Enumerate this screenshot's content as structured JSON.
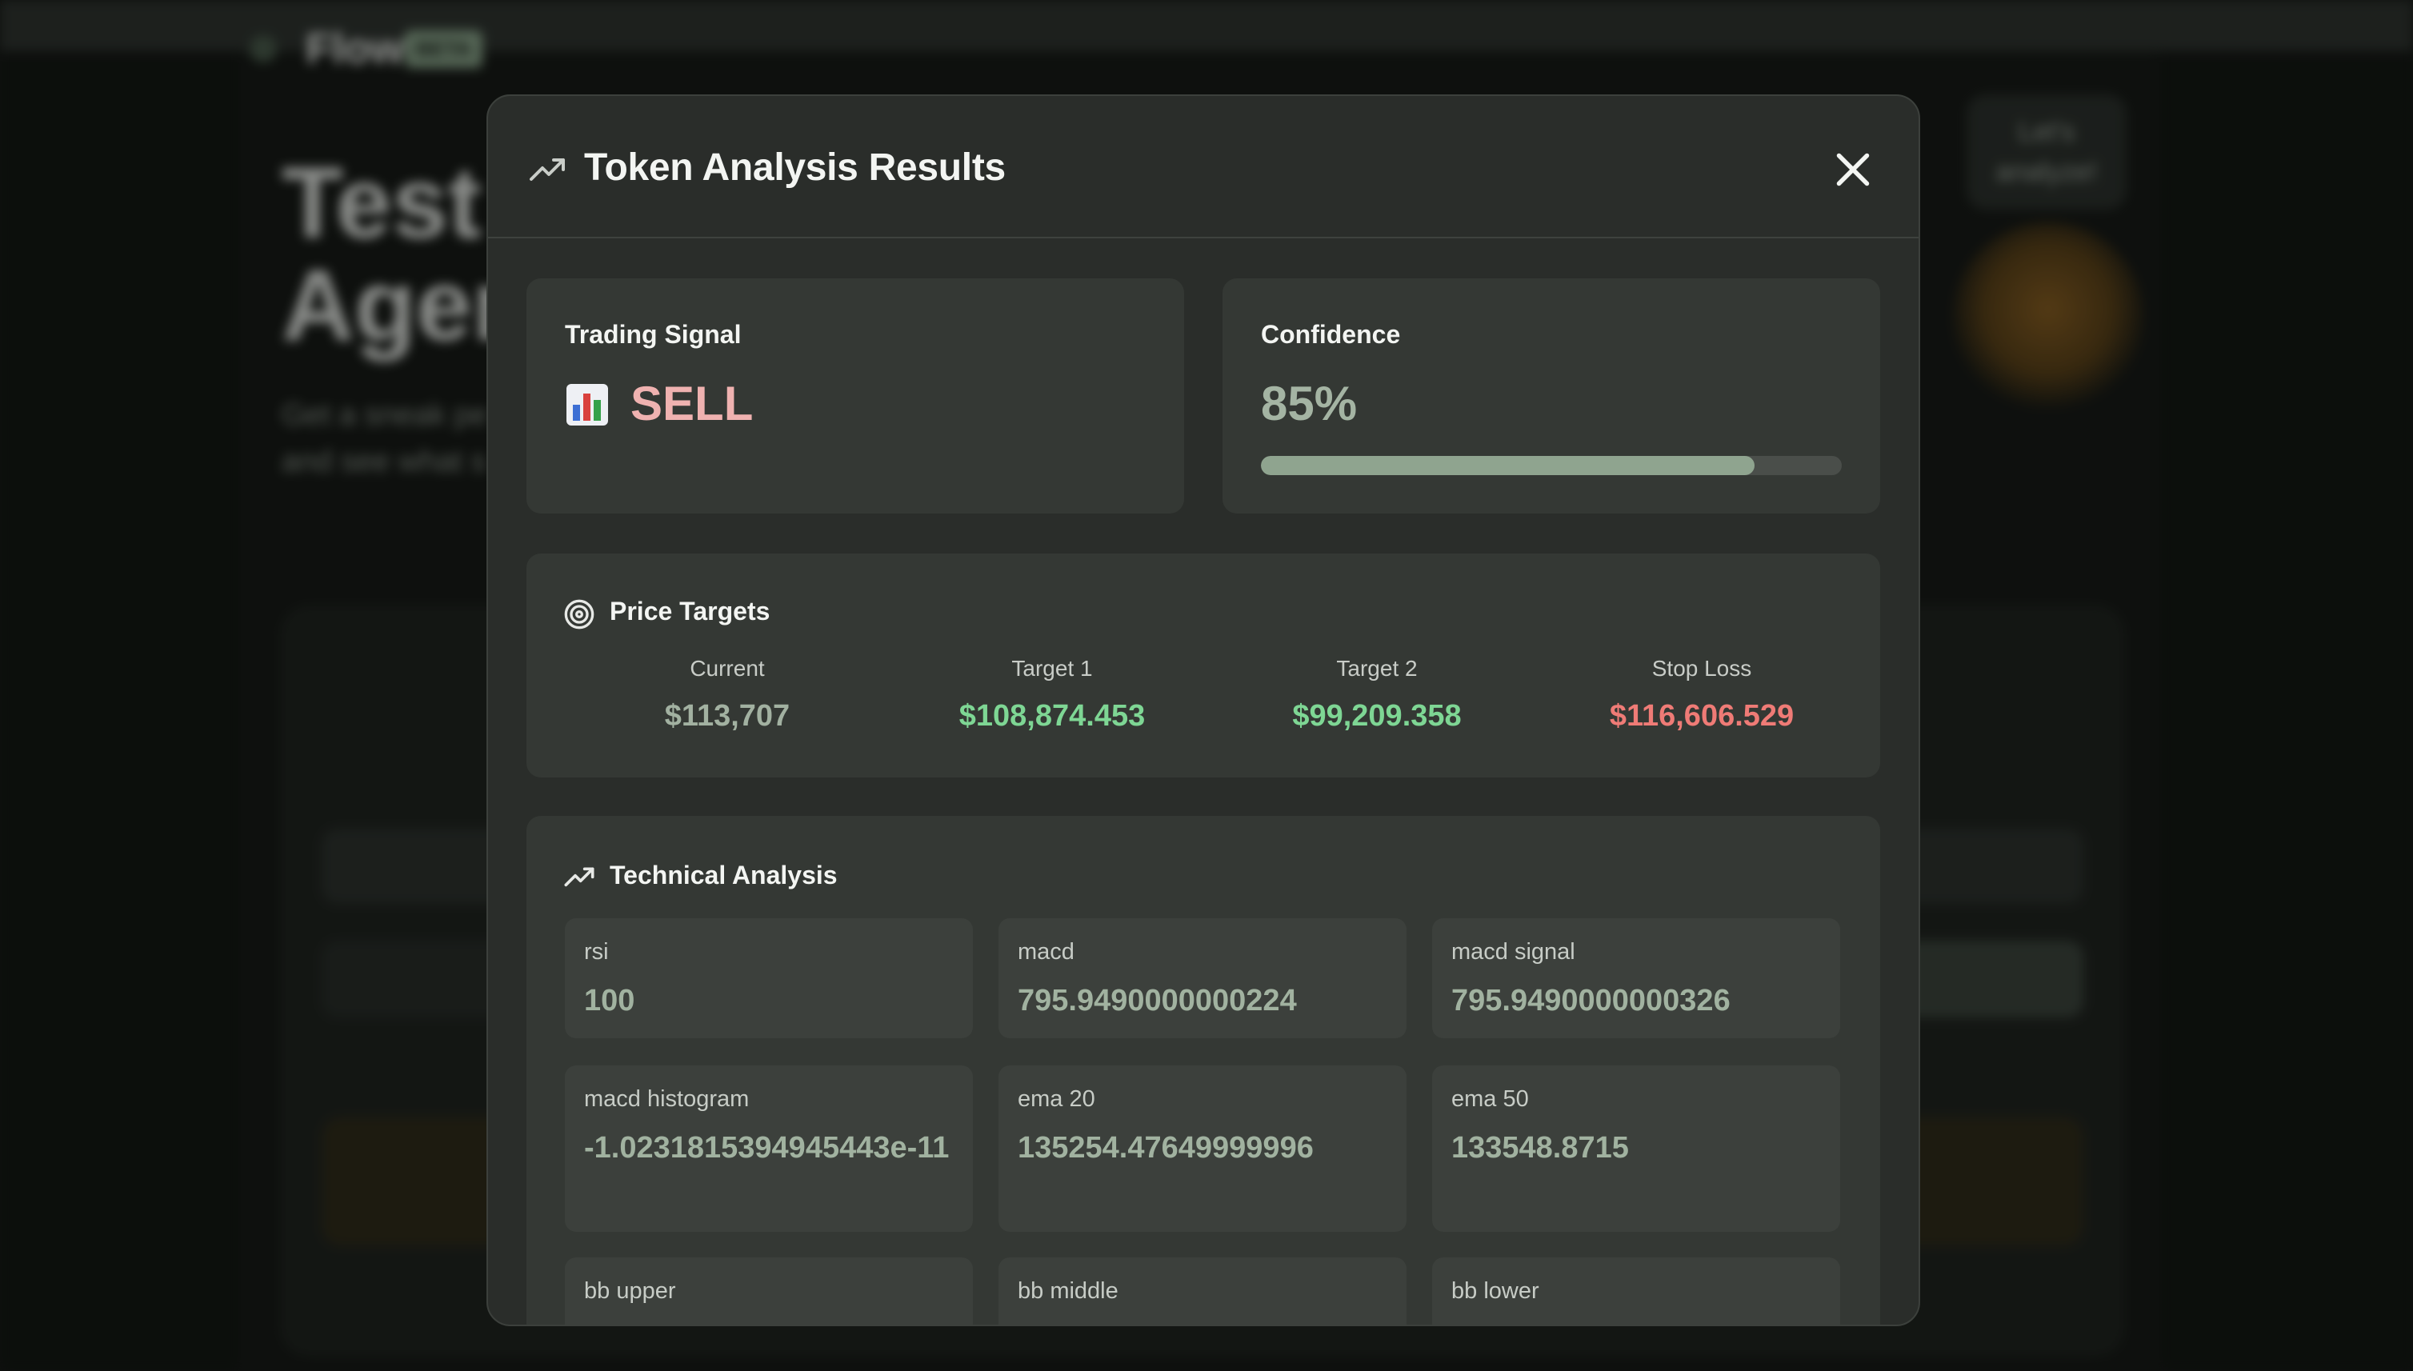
{
  "background": {
    "app_name": "Flow",
    "beta_badge": "BETA",
    "hero_title_line1": "Test",
    "hero_title_line2": "Agen",
    "hero_sub_line1": "Get a sneak pe",
    "hero_sub_line2": "and see what s",
    "cta_label": "Let's analyze!"
  },
  "modal": {
    "title": "Token Analysis Results",
    "header_icon": "trending-up-icon",
    "close_icon": "close-icon"
  },
  "signal": {
    "label": "Trading Signal",
    "icon": "bar-chart-emoji-icon",
    "value": "SELL",
    "color": "#efb2b0"
  },
  "confidence": {
    "label": "Confidence",
    "value": "85%",
    "fraction": 0.85,
    "bar_color": "#8fa48f"
  },
  "price_targets": {
    "label": "Price Targets",
    "icon": "target-icon",
    "items": [
      {
        "label": "Current",
        "value": "$113,707",
        "color": "#a2b1a1"
      },
      {
        "label": "Target 1",
        "value": "$108,874.453",
        "color": "#7ed694"
      },
      {
        "label": "Target 2",
        "value": "$99,209.358",
        "color": "#7ed694"
      },
      {
        "label": "Stop Loss",
        "value": "$116,606.529",
        "color": "#ef7b76"
      }
    ]
  },
  "technical": {
    "label": "Technical Analysis",
    "icon": "trending-up-icon",
    "indicators": [
      {
        "name": "rsi",
        "value": "100"
      },
      {
        "name": "macd",
        "value": "795.9490000000224"
      },
      {
        "name": "macd signal",
        "value": "795.9490000000326"
      },
      {
        "name": "macd histogram",
        "value": "-1.0231815394945443e-11"
      },
      {
        "name": "ema 20",
        "value": "135254.47649999996"
      },
      {
        "name": "ema 50",
        "value": "133548.8715"
      },
      {
        "name": "bb upper",
        "value": ""
      },
      {
        "name": "bb middle",
        "value": ""
      },
      {
        "name": "bb lower",
        "value": ""
      }
    ]
  }
}
